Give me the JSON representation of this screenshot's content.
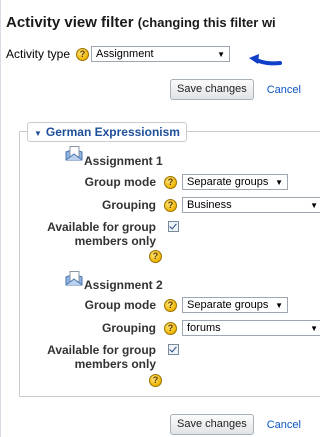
{
  "title": {
    "main": "Activity view filter",
    "sub": "(changing this filter wi"
  },
  "filter": {
    "label": "Activity type",
    "value": "Assignment"
  },
  "buttons": {
    "save": "Save changes",
    "cancel": "Cancel"
  },
  "section": {
    "name": "German Expressionism"
  },
  "labels": {
    "group_mode": "Group mode",
    "grouping": "Grouping",
    "available_line1": "Available for group",
    "available_line2": "members only"
  },
  "assignments": [
    {
      "name": "Assignment 1",
      "group_mode": "Separate groups",
      "grouping": "Business",
      "available": true
    },
    {
      "name": "Assignment 2",
      "group_mode": "Separate groups",
      "grouping": "forums",
      "available": true
    }
  ],
  "colors": {
    "legend": "#1f4f9a",
    "link": "#0b55c4",
    "arrow": "#1040c8"
  },
  "icons": [
    "help-icon",
    "assignment-icon",
    "arrow-annotation-icon",
    "chevron-down-icon"
  ]
}
